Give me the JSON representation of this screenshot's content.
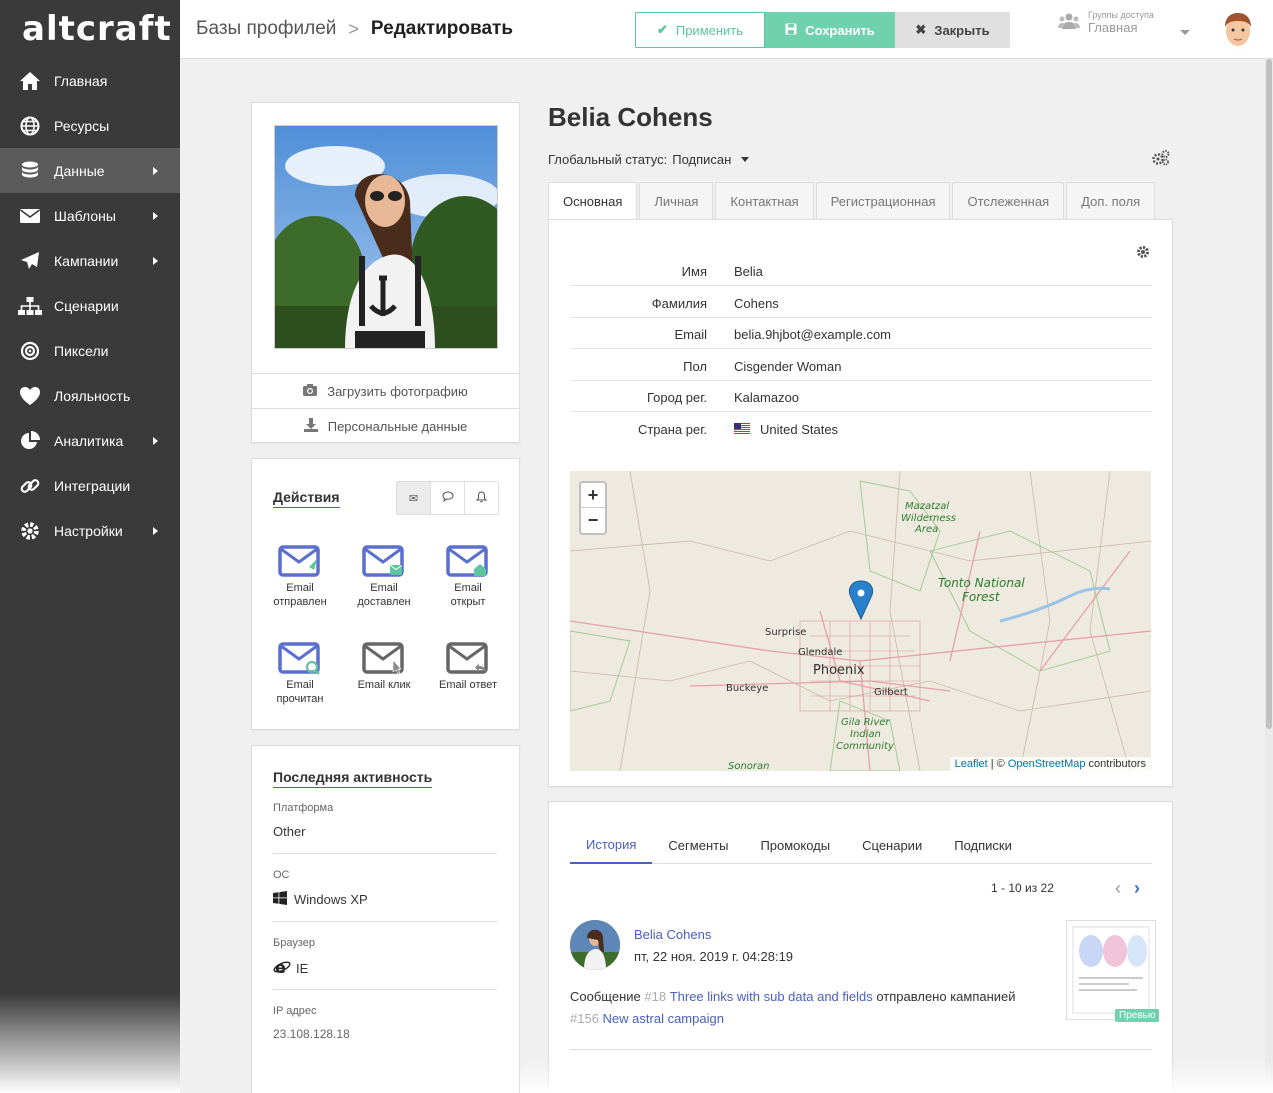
{
  "app": {
    "logo": "altcraft"
  },
  "sidebar": {
    "items": [
      {
        "label": "Главная",
        "icon": "home-icon",
        "arrow": false
      },
      {
        "label": "Ресурсы",
        "icon": "globe-icon",
        "arrow": false
      },
      {
        "label": "Данные",
        "icon": "database-icon",
        "arrow": true,
        "active": true
      },
      {
        "label": "Шаблоны",
        "icon": "envelope-icon",
        "arrow": true
      },
      {
        "label": "Кампании",
        "icon": "paper-plane-icon",
        "arrow": true
      },
      {
        "label": "Сценарии",
        "icon": "sitemap-icon",
        "arrow": false
      },
      {
        "label": "Пиксели",
        "icon": "target-icon",
        "arrow": false
      },
      {
        "label": "Лояльность",
        "icon": "heart-icon",
        "arrow": false
      },
      {
        "label": "Аналитика",
        "icon": "pie-chart-icon",
        "arrow": true
      },
      {
        "label": "Интеграции",
        "icon": "link-icon",
        "arrow": false
      },
      {
        "label": "Настройки",
        "icon": "gear-icon",
        "arrow": true
      }
    ]
  },
  "header": {
    "breadcrumb_parent": "Базы профилей",
    "breadcrumb_current": "Редактировать",
    "apply_label": "Применить",
    "save_label": "Сохранить",
    "close_label": "Закрыть",
    "access_label": "Группы доступа",
    "access_value": "Главная"
  },
  "photo": {
    "upload_label": "Загрузить фотографию",
    "personal_label": "Персональные данные"
  },
  "actions": {
    "title": "Действия",
    "items": [
      {
        "label": "Email отправлен"
      },
      {
        "label": "Email доставлен"
      },
      {
        "label": "Email открыт"
      },
      {
        "label": "Email прочитан"
      },
      {
        "label": "Email клик"
      },
      {
        "label": "Email ответ"
      }
    ]
  },
  "activity": {
    "title": "Последняя активность",
    "platform_label": "Платформа",
    "platform_value": "Other",
    "os_label": "ОС",
    "os_value": "Windows XP",
    "browser_label": "Браузер",
    "browser_value": "IE",
    "ip_label": "IP адрес",
    "ip_value": "23.108.128.18"
  },
  "profile": {
    "name": "Belia Cohens",
    "status_label": "Глобальный статус:",
    "status_value": "Подписан",
    "tabs": [
      "Основная",
      "Личная",
      "Контактная",
      "Регистрационная",
      "Отслеженная",
      "Доп. поля"
    ],
    "fields": [
      {
        "key": "Имя",
        "value": "Belia"
      },
      {
        "key": "Фамилия",
        "value": "Cohens"
      },
      {
        "key": "Email",
        "value": "belia.9hjbot@example.com"
      },
      {
        "key": "Пол",
        "value": "Cisgender Woman"
      },
      {
        "key": "Город рег.",
        "value": "Kalamazoo"
      },
      {
        "key": "Страна рег.",
        "value": "United States"
      }
    ]
  },
  "map": {
    "zoom_in": "+",
    "zoom_out": "−",
    "labels": [
      "Mazatzal",
      "Wilderness",
      "Area",
      "Tonto National",
      "Forest",
      "Surprise",
      "Glendale",
      "Phoenix",
      "Buckeye",
      "Gilbert",
      "Gila River",
      "Indian",
      "Community",
      "Sonoran"
    ],
    "attrib_leaflet": "Leaflet",
    "attrib_sep": " | © ",
    "attrib_osm": "OpenStreetMap",
    "attrib_tail": " contributors"
  },
  "history": {
    "tabs": [
      "История",
      "Сегменты",
      "Промокоды",
      "Сценарии",
      "Подписки"
    ],
    "pager": "1 - 10 из 22",
    "entry": {
      "name": "Belia Cohens",
      "date": "пт, 22 ноя. 2019 г. 04:28:19",
      "msg_prefix": "Сообщение ",
      "msg_num": "#18",
      "msg_link": "Three links with sub data and fields",
      "msg_mid": " отправлено кампанией",
      "camp_num": "#156",
      "camp_link": "New astral campaign",
      "preview": "Превью"
    }
  }
}
